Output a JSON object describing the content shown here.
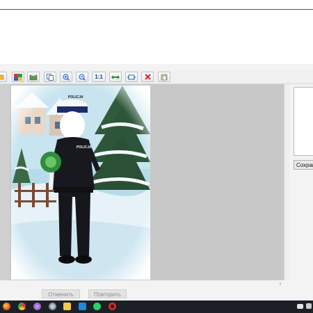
{
  "toolbar": {
    "buttons": [
      {
        "name": "open-icon",
        "label": ""
      },
      {
        "name": "colors-icon",
        "label": ""
      },
      {
        "name": "scanner-icon",
        "label": ""
      },
      {
        "name": "copy-icon",
        "label": ""
      },
      {
        "name": "zoom-in-icon",
        "label": ""
      },
      {
        "name": "zoom-out-icon",
        "label": ""
      },
      {
        "name": "actual-size-button",
        "label": "1:1"
      },
      {
        "name": "fit-width-icon",
        "label": ""
      },
      {
        "name": "fit-window-icon",
        "label": ""
      },
      {
        "name": "delete-icon",
        "label": ""
      },
      {
        "name": "paste-icon",
        "label": ""
      }
    ]
  },
  "photo": {
    "cap_text": "POLICJA",
    "chest_text": "POLICJA",
    "description_colors": {
      "sky": "#a9d4e6",
      "snow": "#f4f8fb",
      "uniform": "#15171d",
      "sign": "#2e8f3a"
    }
  },
  "right_panel": {
    "save_label": "Сохранить"
  },
  "bottom": {
    "cancel_label": "Отменить",
    "repeat_label": "Повторить",
    "scroll_glyph": "›"
  },
  "taskbar": {
    "icons": [
      "firefox-icon",
      "chrome-icon",
      "tor-icon",
      "steam-icon",
      "folder-icon",
      "app-icon",
      "whatsapp-icon",
      "opera-icon",
      "keyboard-icon",
      "volume-icon"
    ]
  }
}
